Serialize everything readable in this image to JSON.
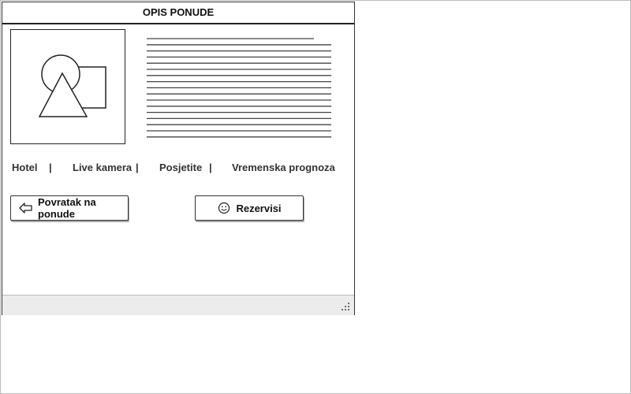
{
  "window": {
    "title": "OPIS PONUDE"
  },
  "image": {
    "icon": "image-placeholder-icon"
  },
  "description": {
    "icon": "text-paragraph-placeholder"
  },
  "tabs": [
    {
      "label": "Hotel"
    },
    {
      "label": "Live kamera"
    },
    {
      "label": "Posjetite"
    },
    {
      "label": "Vremenska prognoza"
    }
  ],
  "separator": "|",
  "buttons": {
    "back": {
      "label": "Povratak na ponude",
      "icon": "arrow-left-icon"
    },
    "reserve": {
      "label": "Rezervisi",
      "icon": "smiley-icon"
    }
  },
  "status_bar": {
    "icon": "resize-grip-icon"
  },
  "colors": {
    "border": "#333333",
    "status_bar": "#ececec",
    "text": "#111111"
  }
}
